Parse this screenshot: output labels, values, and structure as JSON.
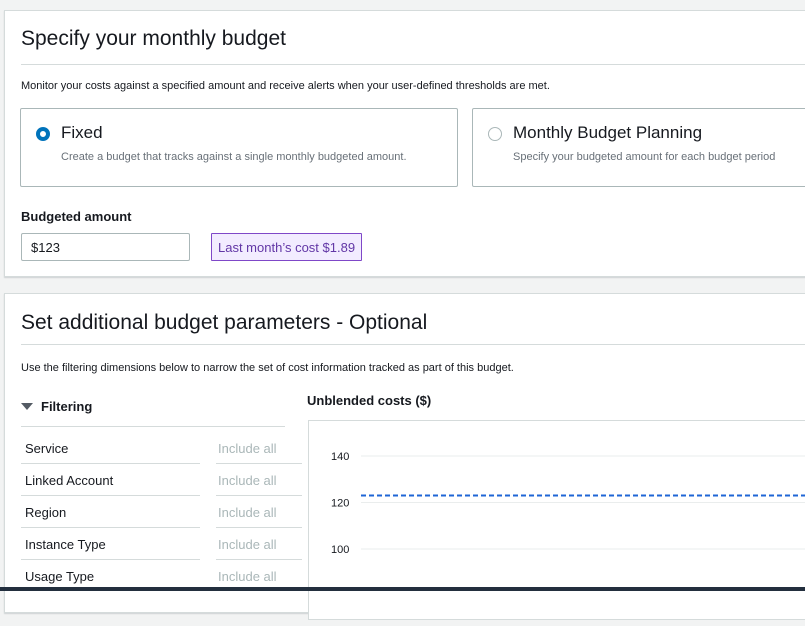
{
  "budget_section": {
    "title": "Specify your monthly budget",
    "description": "Monitor your costs against a specified amount and receive alerts when your user-defined thresholds are met.",
    "options": [
      {
        "label": "Fixed",
        "description": "Create a budget that tracks against a single monthly budgeted amount.",
        "selected": true
      },
      {
        "label": "Monthly Budget Planning",
        "description": "Specify your budgeted amount for each budget period",
        "selected": false
      }
    ],
    "budgeted_amount_label": "Budgeted amount",
    "budgeted_amount_value": "$123",
    "last_month_cost": "Last month’s cost $1.89"
  },
  "parameters_section": {
    "title": "Set additional budget parameters - Optional",
    "description": "Use the filtering dimensions below to narrow the set of cost information tracked as part of this budget.",
    "filtering_label": "Filtering",
    "filters": [
      {
        "name": "Service",
        "value": "Include all"
      },
      {
        "name": "Linked Account",
        "value": "Include all"
      },
      {
        "name": "Region",
        "value": "Include all"
      },
      {
        "name": "Instance Type",
        "value": "Include all"
      },
      {
        "name": "Usage Type",
        "value": "Include all"
      }
    ]
  },
  "chart_data": {
    "type": "line",
    "title": "Unblended costs ($)",
    "y_ticks": [
      140,
      120,
      100
    ],
    "budget_line": 123,
    "budget_line_style": "dashed",
    "budget_line_color": "#1f66d6",
    "grid": true
  },
  "colors": {
    "accent": "#0073bb",
    "badge_bg": "#f2ecff",
    "badge_border": "#7f48c8",
    "badge_text": "#6237a6"
  }
}
